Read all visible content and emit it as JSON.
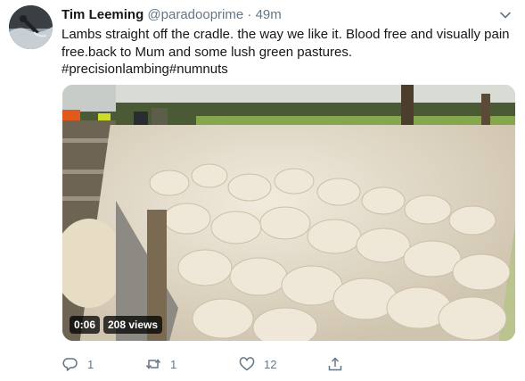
{
  "tweet": {
    "display_name": "Tim Leeming",
    "handle": "@paradooprime",
    "separator": "·",
    "timestamp": "49m",
    "text_lines": [
      "Lambs straight off the cradle. the way we like it. Blood free and visually pain",
      "free.back to Mum and some lush green pastures."
    ],
    "hashtags": [
      "#precisionlambing",
      "#numnuts"
    ]
  },
  "media": {
    "duration": "0:06",
    "views": "208 views"
  },
  "actions": {
    "reply_count": "1",
    "retweet_count": "1",
    "like_count": "12"
  },
  "icons": {
    "avatar": "profile-photo",
    "more": "chevron-down-icon",
    "reply": "reply-icon",
    "retweet": "retweet-icon",
    "like": "heart-icon",
    "share": "share-icon"
  },
  "colors": {
    "text_primary": "#14171a",
    "text_secondary": "#657786",
    "badge_background": "#000000"
  }
}
